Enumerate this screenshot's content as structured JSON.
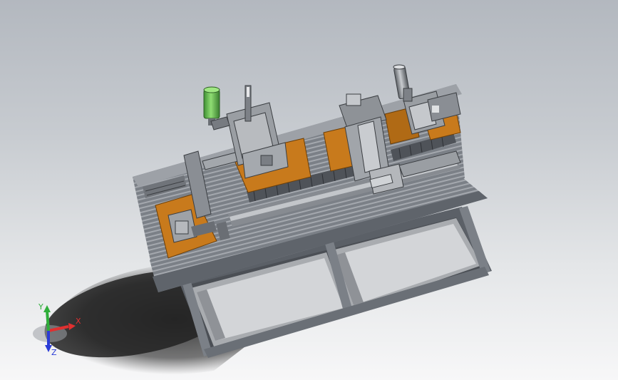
{
  "viewport": {
    "background_top": "#b3b8bf",
    "background_bottom": "#f7f7f8"
  },
  "model": {
    "frame_color": "#6f747b",
    "plate_color": "#c87a1c",
    "cylinder_color": "#5fb64a",
    "panel_color": "#d3d5d8"
  },
  "triad": {
    "x_label": "X",
    "y_label": "Y",
    "z_label": "Z",
    "x_color": "#e03030",
    "y_color": "#2fae3a",
    "z_color": "#2a3bd6"
  }
}
